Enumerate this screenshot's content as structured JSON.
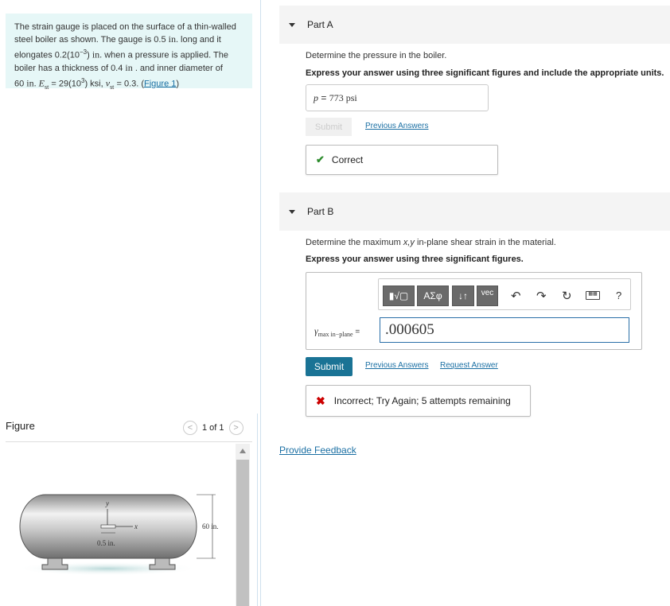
{
  "problem": {
    "line1": "The strain gauge is placed on the surface of a thin-walled",
    "line2": "steel boiler as shown. The gauge is 0.5",
    "in1": "in.",
    "line2b": " long and it",
    "line3a": "elongates 0.2(10",
    "exp1": "−3",
    "line3b": ") ",
    "in2": "in.",
    "line3c": " when a pressure is applied. The",
    "line4a": "boiler has a thickness of 0.4 ",
    "in3": "in",
    "line4b": " . and inner diameter of",
    "line5a": "60 ",
    "in4": "in.",
    "E": " E",
    "Esub": "st",
    "Eval": " = 29(10",
    "exp2": "3",
    "Eunit": ") ksi, ",
    "nu": "ν",
    "nusub": "st",
    "nuval": " = 0.3. (",
    "figlink": "Figure 1",
    "close": ")"
  },
  "figure": {
    "title": "Figure",
    "pager": "1 of 1",
    "prev_icon": "chevron-left-icon",
    "next_icon": "chevron-right-icon",
    "label_y": "y",
    "label_x": "x",
    "label_gauge": "0.5 in.",
    "label_diameter": "60 in."
  },
  "partA": {
    "title": "Part A",
    "question": "Determine the pressure in the boiler.",
    "instruction": "Express your answer using three significant figures and include the appropriate units.",
    "var": "p",
    "eq": " = ",
    "answer": "773 psi",
    "submit": "Submit",
    "previous": "Previous Answers",
    "feedback": "Correct"
  },
  "partB": {
    "title": "Part B",
    "question_a": "Determine the maximum ",
    "question_var": "x,y",
    "question_b": " in-plane shear strain in the material.",
    "instruction": "Express your answer using three significant figures.",
    "toolbar": {
      "templates": "▮√▢",
      "greek": "ΑΣφ",
      "arrows": "↓↑",
      "vec": "vec",
      "undo_icon": "undo-icon",
      "redo_icon": "redo-icon",
      "reset_icon": "reset-icon",
      "keyboard_icon": "keyboard-icon",
      "help": "?"
    },
    "gamma": "γ",
    "gamma_sub": "max in−plane",
    "eq": " = ",
    "value": ".000605",
    "submit": "Submit",
    "previous": "Previous Answers",
    "request": "Request Answer",
    "feedback": "Incorrect; Try Again; 5 attempts remaining"
  },
  "provide_feedback": "Provide Feedback",
  "colors": {
    "accent": "#1a7395",
    "link": "#1a6fa3",
    "correct": "#2d8c2d",
    "incorrect": "#cc0000",
    "problem_bg": "#e6f7f7"
  }
}
